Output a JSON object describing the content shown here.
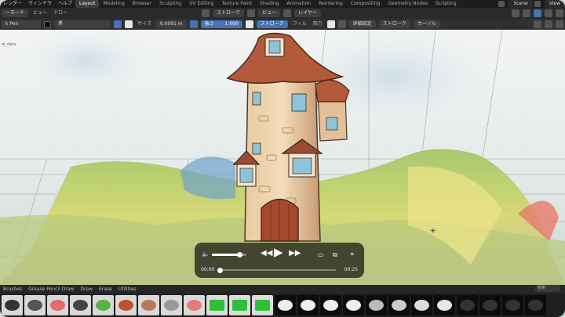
{
  "menu": {
    "items": [
      "レンダー",
      "ウィンドウ",
      "ヘルプ"
    ],
    "workspaces": [
      "Layout",
      "Modeling",
      "Browser",
      "Sculpting",
      "UV Editing",
      "Texture Paint",
      "Shading",
      "Animation",
      "Rendering",
      "Compositing",
      "Geometry Nodes",
      "Scripting"
    ],
    "active_workspace": "Layout",
    "scene": "Scene",
    "view_layer": "View"
  },
  "header1": {
    "mode": "ーモード",
    "view": "ビュー",
    "draw": "ドロー",
    "stroke_dropdown": "ストローク",
    "view_dropdown": "ビュー",
    "layer_dropdown": "レイヤー"
  },
  "header2": {
    "tool": "k Pen",
    "color_name": "黒",
    "size_label": "サイズ",
    "size_value": "0.0091 m",
    "strength_label": "強さ",
    "strength_value": "1.000",
    "stroke_button": "ストローク",
    "fill_button": "フィル",
    "both_button": "両方",
    "advanced": "詳細設定",
    "stroke_menu": "ストローク",
    "cursor_menu": "カーソル"
  },
  "viewport": {
    "object_label": "ol_data"
  },
  "shelf": {
    "tabs": [
      "Brushes",
      "Grease Pencil Draw",
      "Draw",
      "Erase",
      "Utilities"
    ],
    "search_placeholder": "検索"
  },
  "player": {
    "current_time": "00:00",
    "duration": "00:25",
    "progress": 0.0,
    "volume": 0.8
  },
  "colors": {
    "accent": "#4772b3",
    "panel": "#2a2a2a",
    "menubar": "#1d1d1d"
  }
}
